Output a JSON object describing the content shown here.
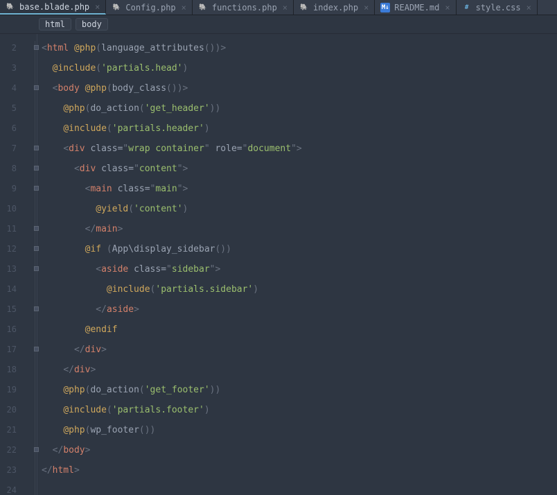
{
  "tabs": [
    {
      "icon": "php",
      "label": "base.blade.php",
      "active": true
    },
    {
      "icon": "php",
      "label": "Config.php",
      "active": false
    },
    {
      "icon": "php",
      "label": "functions.php",
      "active": false
    },
    {
      "icon": "php",
      "label": "index.php",
      "active": false
    },
    {
      "icon": "md",
      "label": "README.md",
      "active": false
    },
    {
      "icon": "css",
      "label": "style.css",
      "active": false
    }
  ],
  "breadcrumbs": [
    "html",
    "body"
  ],
  "lines": [
    {
      "n": 2,
      "seg": [
        [
          "c-p",
          "<"
        ],
        [
          "c-tag",
          "html"
        ],
        [
          "",
          ""
        ],
        [
          "c-dir",
          " @php"
        ],
        [
          "c-p",
          "("
        ],
        [
          "c-fn",
          "language_attributes"
        ],
        [
          "c-p",
          "())"
        ],
        [
          "c-p",
          ">"
        ]
      ]
    },
    {
      "n": 3,
      "seg": [
        [
          "",
          "  "
        ],
        [
          "c-dir",
          "@include"
        ],
        [
          "c-p",
          "("
        ],
        [
          "c-str",
          "'partials.head'"
        ],
        [
          "c-p",
          ")"
        ]
      ]
    },
    {
      "n": 4,
      "seg": [
        [
          "",
          "  "
        ],
        [
          "c-p",
          "<"
        ],
        [
          "c-tag",
          "body"
        ],
        [
          "c-dir",
          " @php"
        ],
        [
          "c-p",
          "("
        ],
        [
          "c-fn",
          "body_class"
        ],
        [
          "c-p",
          "())"
        ],
        [
          "c-p",
          ">"
        ]
      ]
    },
    {
      "n": 5,
      "seg": [
        [
          "",
          "    "
        ],
        [
          "c-dir",
          "@php"
        ],
        [
          "c-p",
          "("
        ],
        [
          "c-fn",
          "do_action"
        ],
        [
          "c-p",
          "("
        ],
        [
          "c-str",
          "'get_header'"
        ],
        [
          "c-p",
          "))"
        ]
      ]
    },
    {
      "n": 6,
      "seg": [
        [
          "",
          "    "
        ],
        [
          "c-dir",
          "@include"
        ],
        [
          "c-p",
          "("
        ],
        [
          "c-str",
          "'partials.header'"
        ],
        [
          "c-p",
          ")"
        ]
      ]
    },
    {
      "n": 7,
      "seg": [
        [
          "",
          "    "
        ],
        [
          "c-p",
          "<"
        ],
        [
          "c-tag",
          "div"
        ],
        [
          "c-attr",
          " class="
        ],
        [
          "c-p",
          "\""
        ],
        [
          "c-val",
          "wrap container"
        ],
        [
          "c-p",
          "\""
        ],
        [
          "c-attr",
          " role="
        ],
        [
          "c-p",
          "\""
        ],
        [
          "c-val",
          "document"
        ],
        [
          "c-p",
          "\""
        ],
        [
          "c-p",
          ">"
        ]
      ]
    },
    {
      "n": 8,
      "seg": [
        [
          "",
          "      "
        ],
        [
          "c-p",
          "<"
        ],
        [
          "c-tag",
          "div"
        ],
        [
          "c-attr",
          " class="
        ],
        [
          "c-p",
          "\""
        ],
        [
          "c-val",
          "content"
        ],
        [
          "c-p",
          "\""
        ],
        [
          "c-p",
          ">"
        ]
      ]
    },
    {
      "n": 9,
      "seg": [
        [
          "",
          "        "
        ],
        [
          "c-p",
          "<"
        ],
        [
          "c-tag",
          "main"
        ],
        [
          "c-attr",
          " class="
        ],
        [
          "c-p",
          "\""
        ],
        [
          "c-val",
          "main"
        ],
        [
          "c-p",
          "\""
        ],
        [
          "c-p",
          ">"
        ]
      ]
    },
    {
      "n": 10,
      "seg": [
        [
          "",
          "          "
        ],
        [
          "c-dir",
          "@yield"
        ],
        [
          "c-p",
          "("
        ],
        [
          "c-str",
          "'content'"
        ],
        [
          "c-p",
          ")"
        ]
      ]
    },
    {
      "n": 11,
      "seg": [
        [
          "",
          "        "
        ],
        [
          "c-p",
          "</"
        ],
        [
          "c-tag",
          "main"
        ],
        [
          "c-p",
          ">"
        ]
      ]
    },
    {
      "n": 12,
      "seg": [
        [
          "",
          "        "
        ],
        [
          "c-dir",
          "@if"
        ],
        [
          "",
          ""
        ],
        [
          "c-p",
          " ("
        ],
        [
          "c-fn",
          "App\\display_sidebar"
        ],
        [
          "c-p",
          "())"
        ]
      ]
    },
    {
      "n": 13,
      "seg": [
        [
          "",
          "          "
        ],
        [
          "c-p",
          "<"
        ],
        [
          "c-tag",
          "aside"
        ],
        [
          "c-attr",
          " class="
        ],
        [
          "c-p",
          "\""
        ],
        [
          "c-val",
          "sidebar"
        ],
        [
          "c-p",
          "\""
        ],
        [
          "c-p",
          ">"
        ]
      ]
    },
    {
      "n": 14,
      "seg": [
        [
          "",
          "            "
        ],
        [
          "c-dir",
          "@include"
        ],
        [
          "c-p",
          "("
        ],
        [
          "c-str",
          "'partials.sidebar'"
        ],
        [
          "c-p",
          ")"
        ]
      ]
    },
    {
      "n": 15,
      "seg": [
        [
          "",
          "          "
        ],
        [
          "c-p",
          "</"
        ],
        [
          "c-tag",
          "aside"
        ],
        [
          "c-p",
          ">"
        ]
      ]
    },
    {
      "n": 16,
      "seg": [
        [
          "",
          "        "
        ],
        [
          "c-dir",
          "@endif"
        ]
      ]
    },
    {
      "n": 17,
      "seg": [
        [
          "",
          "      "
        ],
        [
          "c-p",
          "</"
        ],
        [
          "c-tag",
          "div"
        ],
        [
          "c-p",
          ">"
        ]
      ]
    },
    {
      "n": 18,
      "seg": [
        [
          "",
          "    "
        ],
        [
          "c-p",
          "</"
        ],
        [
          "c-tag",
          "div"
        ],
        [
          "c-p",
          ">"
        ]
      ]
    },
    {
      "n": 19,
      "seg": [
        [
          "",
          "    "
        ],
        [
          "c-dir",
          "@php"
        ],
        [
          "c-p",
          "("
        ],
        [
          "c-fn",
          "do_action"
        ],
        [
          "c-p",
          "("
        ],
        [
          "c-str",
          "'get_footer'"
        ],
        [
          "c-p",
          "))"
        ]
      ]
    },
    {
      "n": 20,
      "seg": [
        [
          "",
          "    "
        ],
        [
          "c-dir",
          "@include"
        ],
        [
          "c-p",
          "("
        ],
        [
          "c-str",
          "'partials.footer'"
        ],
        [
          "c-p",
          ")"
        ]
      ]
    },
    {
      "n": 21,
      "seg": [
        [
          "",
          "    "
        ],
        [
          "c-dir",
          "@php"
        ],
        [
          "c-p",
          "("
        ],
        [
          "c-fn",
          "wp_footer"
        ],
        [
          "c-p",
          "())"
        ]
      ]
    },
    {
      "n": 22,
      "seg": [
        [
          "",
          "  "
        ],
        [
          "c-p",
          "</"
        ],
        [
          "c-tag",
          "body"
        ],
        [
          "c-p",
          ">"
        ]
      ]
    },
    {
      "n": 23,
      "seg": [
        [
          "c-p",
          "</"
        ],
        [
          "c-tag",
          "html"
        ],
        [
          "c-p",
          ">"
        ]
      ]
    },
    {
      "n": 24,
      "seg": [
        [
          "",
          ""
        ]
      ]
    }
  ],
  "foldRows": [
    2,
    4,
    7,
    8,
    9,
    11,
    12,
    13,
    15,
    17,
    22
  ]
}
